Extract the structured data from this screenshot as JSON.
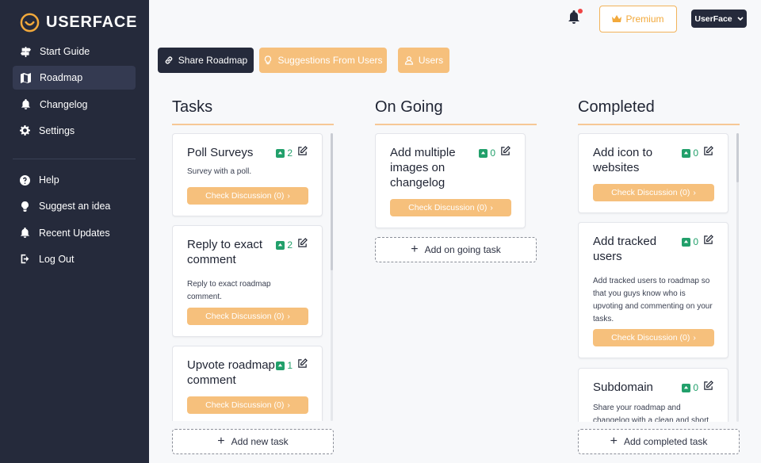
{
  "brand": {
    "name": "USERFACE",
    "accent": "#f2a93b"
  },
  "sidebar": {
    "primary": [
      {
        "label": "Start Guide",
        "icon": "signpost-icon"
      },
      {
        "label": "Roadmap",
        "icon": "map-icon",
        "active": true
      },
      {
        "label": "Changelog",
        "icon": "bell-icon"
      },
      {
        "label": "Settings",
        "icon": "gear-icon"
      }
    ],
    "secondary": [
      {
        "label": "Help",
        "icon": "question-icon"
      },
      {
        "label": "Suggest an idea",
        "icon": "lightbulb-icon"
      },
      {
        "label": "Recent Updates",
        "icon": "bell-icon"
      },
      {
        "label": "Log Out",
        "icon": "logout-icon"
      }
    ]
  },
  "topbar": {
    "premium_label": "Premium",
    "user_label": "UserFace"
  },
  "actions": {
    "share": "Share Roadmap",
    "suggestions": "Suggestions From Users",
    "users": "Users"
  },
  "columns": {
    "tasks": {
      "title": "Tasks",
      "add_label": "Add new task",
      "cards": [
        {
          "title": "Poll Surveys",
          "votes": "2",
          "desc": "Survey with a poll.",
          "discussion": "Check Discussion (0)"
        },
        {
          "title": "Reply to exact comment",
          "votes": "2",
          "desc": "Reply to exact roadmap comment.",
          "discussion": "Check Discussion (0)"
        },
        {
          "title": "Upvote roadmap comment",
          "votes": "1",
          "desc": "",
          "discussion": "Check Discussion (0)"
        }
      ]
    },
    "ongoing": {
      "title": "On Going",
      "add_label": "Add on going task",
      "cards": [
        {
          "title": "Add multiple images on changelog",
          "votes": "0",
          "desc": "",
          "discussion": "Check Discussion (0)"
        }
      ]
    },
    "completed": {
      "title": "Completed",
      "add_label": "Add completed task",
      "cards": [
        {
          "title": "Add icon to websites",
          "votes": "0",
          "desc": "",
          "discussion": "Check Discussion (0)"
        },
        {
          "title": "Add tracked users",
          "votes": "0",
          "desc": "Add tracked users to roadmap so that you guys know who is upvoting and commenting on your tasks.",
          "discussion": "Check Discussion (0)"
        },
        {
          "title": "Subdomain",
          "votes": "0",
          "desc": "Share your roadmap and changelog with a clean and short",
          "discussion": ""
        }
      ]
    }
  }
}
